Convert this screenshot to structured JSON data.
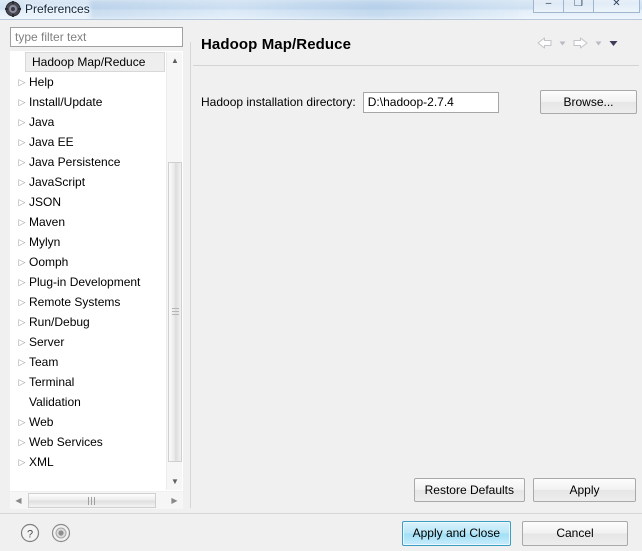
{
  "window": {
    "title": "Preferences",
    "icon": "preferences-icon",
    "controls": [
      {
        "name": "minimize-button",
        "glyph": "–"
      },
      {
        "name": "maximize-button",
        "glyph": "❐"
      },
      {
        "name": "close-button",
        "glyph": "✕"
      }
    ]
  },
  "sidebar": {
    "filter": {
      "value": "",
      "placeholder": "type filter text"
    },
    "items": [
      {
        "label": "Hadoop Map/Reduce",
        "expandable": true,
        "selected": true
      },
      {
        "label": "Help",
        "expandable": true,
        "selected": false
      },
      {
        "label": "Install/Update",
        "expandable": true,
        "selected": false
      },
      {
        "label": "Java",
        "expandable": true,
        "selected": false
      },
      {
        "label": "Java EE",
        "expandable": true,
        "selected": false
      },
      {
        "label": "Java Persistence",
        "expandable": true,
        "selected": false
      },
      {
        "label": "JavaScript",
        "expandable": true,
        "selected": false
      },
      {
        "label": "JSON",
        "expandable": true,
        "selected": false
      },
      {
        "label": "Maven",
        "expandable": true,
        "selected": false
      },
      {
        "label": "Mylyn",
        "expandable": true,
        "selected": false
      },
      {
        "label": "Oomph",
        "expandable": true,
        "selected": false
      },
      {
        "label": "Plug-in Development",
        "expandable": true,
        "selected": false
      },
      {
        "label": "Remote Systems",
        "expandable": true,
        "selected": false
      },
      {
        "label": "Run/Debug",
        "expandable": true,
        "selected": false
      },
      {
        "label": "Server",
        "expandable": true,
        "selected": false
      },
      {
        "label": "Team",
        "expandable": true,
        "selected": false
      },
      {
        "label": "Terminal",
        "expandable": true,
        "selected": false
      },
      {
        "label": "Validation",
        "expandable": false,
        "selected": false
      },
      {
        "label": "Web",
        "expandable": true,
        "selected": false
      },
      {
        "label": "Web Services",
        "expandable": true,
        "selected": false
      },
      {
        "label": "XML",
        "expandable": true,
        "selected": false
      }
    ],
    "expand_glyph": "▷",
    "vscroll": {
      "up_glyph": "▲",
      "down_glyph": "▼"
    },
    "hscroll": {
      "left_glyph": "◀",
      "right_glyph": "▶"
    }
  },
  "main": {
    "title": "Hadoop Map/Reduce",
    "nav": {
      "back": "back-arrow",
      "back_menu": "▼",
      "forward": "forward-arrow",
      "forward_menu": "▼",
      "view_menu": "▼"
    },
    "field": {
      "label": "Hadoop installation directory:",
      "value": "D:\\hadoop-2.7.4",
      "placeholder": "",
      "browse_label": "Browse..."
    },
    "actions": {
      "restore_defaults": "Restore Defaults",
      "apply": "Apply"
    }
  },
  "footer": {
    "help_icon": "question-mark-icon",
    "secondary_icon": "record-circle-icon",
    "apply_and_close": "Apply and Close",
    "cancel": "Cancel"
  },
  "colors": {
    "panel_bg": "#f0f0f0",
    "focus_accent": "#9fdff6",
    "focus_border": "#3c9dc4",
    "title_text": "#11263b"
  }
}
